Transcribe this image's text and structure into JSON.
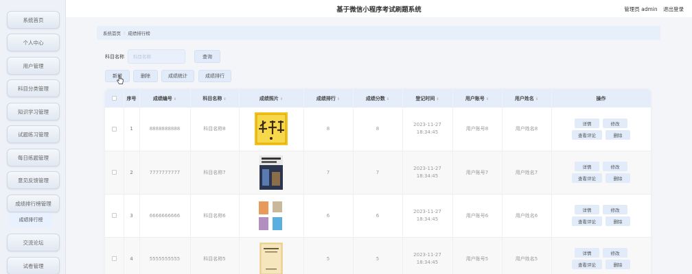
{
  "header": {
    "title": "基于微信小程序考试刷题系统",
    "user": "管理员 admin",
    "logout": "退出登录"
  },
  "sidebar": {
    "items": [
      {
        "label": "系统首页"
      },
      {
        "label": "个人中心"
      },
      {
        "label": "用户管理"
      },
      {
        "label": "科目分类管理"
      },
      {
        "label": "知识学习管理"
      },
      {
        "label": "试题练习管理"
      },
      {
        "label": "每日练题管理"
      },
      {
        "label": "意见反馈管理"
      },
      {
        "label": "成绩排行榜管理"
      },
      {
        "label": "交流论坛"
      },
      {
        "label": "试卷管理"
      }
    ],
    "sub_item": "成绩排行榜"
  },
  "breadcrumb": {
    "home": "系统首页",
    "current": "成绩排行榜"
  },
  "search": {
    "label": "科目名称",
    "placeholder": "科目名称",
    "button": "查询"
  },
  "actions": {
    "add": "新增",
    "delete": "删除",
    "stats": "成绩统计",
    "ranking": "成绩排行"
  },
  "table": {
    "columns": [
      "序号",
      "成绩编号",
      "科目名称",
      "成绩照片",
      "成绩排行",
      "成绩分数",
      "登记时间",
      "用户账号",
      "用户姓名",
      "操作"
    ],
    "rows": [
      {
        "index": "1",
        "code": "8888888888",
        "subject": "科目名称8",
        "rank": "8",
        "score": "8",
        "time": "2023-11-27 18:34:45",
        "account": "用户账号8",
        "name": "用户姓名8"
      },
      {
        "index": "2",
        "code": "7777777777",
        "subject": "科目名称7",
        "rank": "7",
        "score": "7",
        "time": "2023-11-27 18:34:45",
        "account": "用户账号7",
        "name": "用户姓名7"
      },
      {
        "index": "3",
        "code": "6666666666",
        "subject": "科目名称6",
        "rank": "6",
        "score": "6",
        "time": "2023-11-27 18:34:45",
        "account": "用户账号6",
        "name": "用户姓名6"
      },
      {
        "index": "4",
        "code": "5555555555",
        "subject": "科目名称5",
        "rank": "5",
        "score": "5",
        "time": "2023-11-27 18:34:45",
        "account": "用户账号5",
        "name": "用户姓名5"
      }
    ],
    "ops": {
      "detail": "详情",
      "edit": "修改",
      "review": "查看评论",
      "delete": "删除"
    }
  },
  "colors": {
    "sidebar_bg": "#eef2f8",
    "header_bg": "#e4edf9",
    "button_bg": "#e1ebfa"
  }
}
